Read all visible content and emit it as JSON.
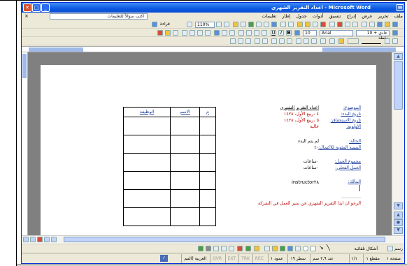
{
  "window": {
    "title": "اعداد التقرير الشهري - Microsoft Word",
    "minimize": "_",
    "maximize": "□",
    "close": "✕"
  },
  "menu": {
    "items": [
      "ملف",
      "تحرير",
      "عرض",
      "إدراج",
      "تنسيق",
      "أدوات",
      "جدول",
      "إطار",
      "تعليمات"
    ],
    "help_placeholder": "اكتب سؤالاً للتعليمات",
    "close": "×"
  },
  "toolbar": {
    "reading_label": "قراءة",
    "zoom": "110%",
    "style": "عادي + 10 نقطة",
    "font": "Arial",
    "size": "10"
  },
  "document": {
    "labels": {
      "subject": "الموضوع:",
      "start_date": "تاريخ البدء:",
      "due_date": "تاريخ الاستحقاق:",
      "priority": "الأولوية:",
      "status": "الحالة:",
      "percent_complete": "النسبة المئوية للاكتمال:",
      "total_work": "مجموع العمل:",
      "actual_work": "العمل الفعلي:",
      "owner": "المالك:"
    },
    "values": {
      "subject": "اعداد التقرير الشهري",
      "start_date": "٤ ،ربيع الأول، ١٤٢٨",
      "due_date": "٥ ،ربيع الأول، ١٤٢٨",
      "priority": "عالية",
      "status": "لم يتم البدء",
      "percent_complete": "٠٪",
      "total_work": "٠ساعات",
      "actual_work": "٠ساعات",
      "owner": "instructor٢٨"
    },
    "dots": "..............",
    "footer_text": "الرجو ان ابدا التقرير الشهري عن سير العمل في الشركة",
    "table_headers": [
      "م",
      "الاسم",
      "الوظيفة"
    ],
    "table_rows": 6
  },
  "drawing": {
    "draw_label": "رسم",
    "autoshapes_label": "أشكال تلقائية"
  },
  "status": {
    "page": "صفحة ١",
    "section": "مقطع ١",
    "page_of": "١/١",
    "position": "عند ٢,٩ سم",
    "line": "سطر ١٩",
    "column": "عمود ١",
    "rec": "REC",
    "trk": "TRK",
    "ext": "EXT",
    "ovr": "OVR",
    "language": "العربية (المم"
  }
}
